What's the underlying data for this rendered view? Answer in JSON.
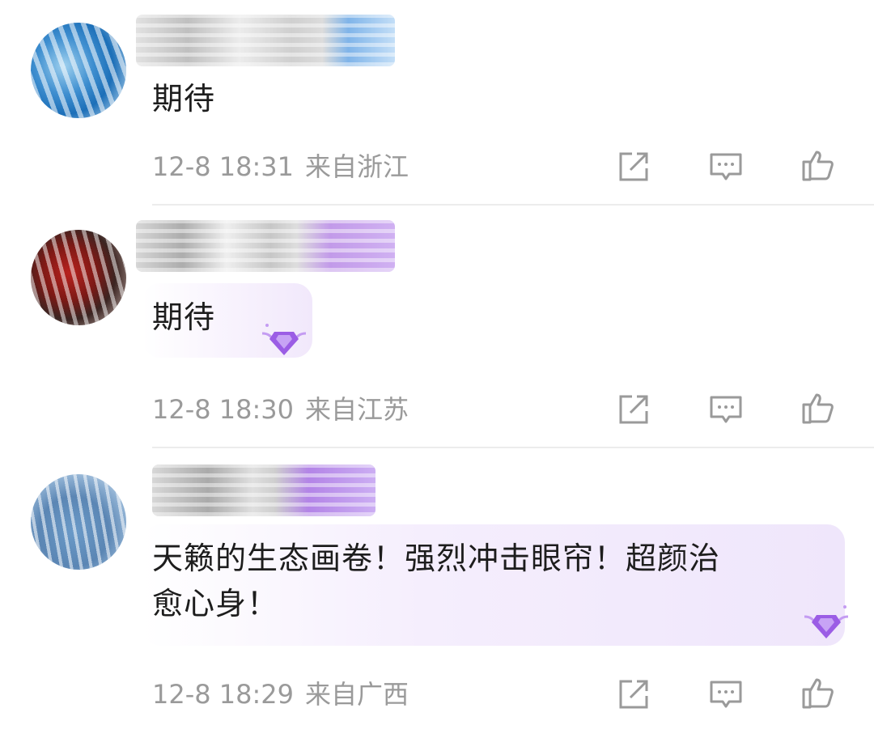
{
  "comments": [
    {
      "text": "期待",
      "date": "12-8 18:31",
      "region": "来自浙江"
    },
    {
      "text": "期待",
      "date": "12-8 18:30",
      "region": "来自江苏"
    },
    {
      "text_line1": "天籁的生态画卷！强烈冲击眼帘！超颜治",
      "text_line2": "愈心身！",
      "date": "12-8 18:29",
      "region": "来自广西"
    }
  ],
  "icons": {
    "share": "share-icon",
    "reply": "comment-icon",
    "like": "thumbs-up-icon",
    "badge": "vip-gem-badge-icon"
  },
  "colors": {
    "meta_text": "#9a9a9a",
    "badge_purple": "#9b5de5",
    "bubble_bg": "#f3ecfc"
  }
}
